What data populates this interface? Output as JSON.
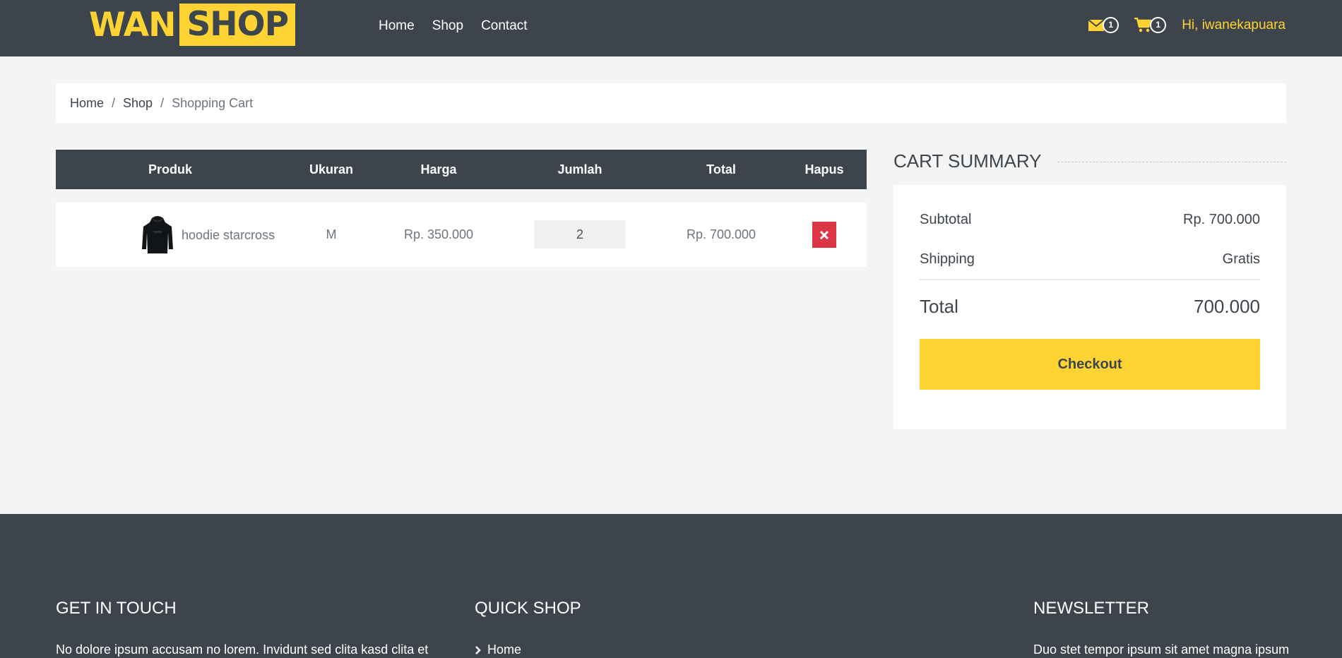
{
  "brand": {
    "part1": "WAN",
    "part2": "SHOP"
  },
  "nav": {
    "home": "Home",
    "shop": "Shop",
    "contact": "Contact"
  },
  "header": {
    "message_count": "1",
    "cart_count": "1",
    "greeting": "Hi, iwanekapuara"
  },
  "breadcrumb": {
    "home": "Home",
    "shop": "Shop",
    "current": "Shopping Cart"
  },
  "cart": {
    "columns": {
      "product": "Produk",
      "size": "Ukuran",
      "price": "Harga",
      "qty": "Jumlah",
      "total": "Total",
      "remove": "Hapus"
    },
    "items": [
      {
        "name": "hoodie starcross",
        "size": "M",
        "price": "Rp. 350.000",
        "qty": "2",
        "total": "Rp. 700.000"
      }
    ]
  },
  "summary": {
    "title": "CART SUMMARY",
    "subtotal_label": "Subtotal",
    "subtotal_value": "Rp. 700.000",
    "shipping_label": "Shipping",
    "shipping_value": "Gratis",
    "total_label": "Total",
    "total_value": "700.000",
    "checkout_label": "Checkout"
  },
  "footer": {
    "contact_title": "GET IN TOUCH",
    "contact_text": "No dolore ipsum accusam no lorem. Invidunt sed clita kasd clita et",
    "quick_title": "QUICK SHOP",
    "quick_items": [
      "Home"
    ],
    "newsletter_title": "NEWSLETTER",
    "newsletter_text": "Duo stet tempor ipsum sit amet magna ipsum"
  },
  "colors": {
    "primary": "#ffd333",
    "dark": "#3d444c",
    "danger": "#dc3545",
    "background": "#f4f4f4"
  }
}
